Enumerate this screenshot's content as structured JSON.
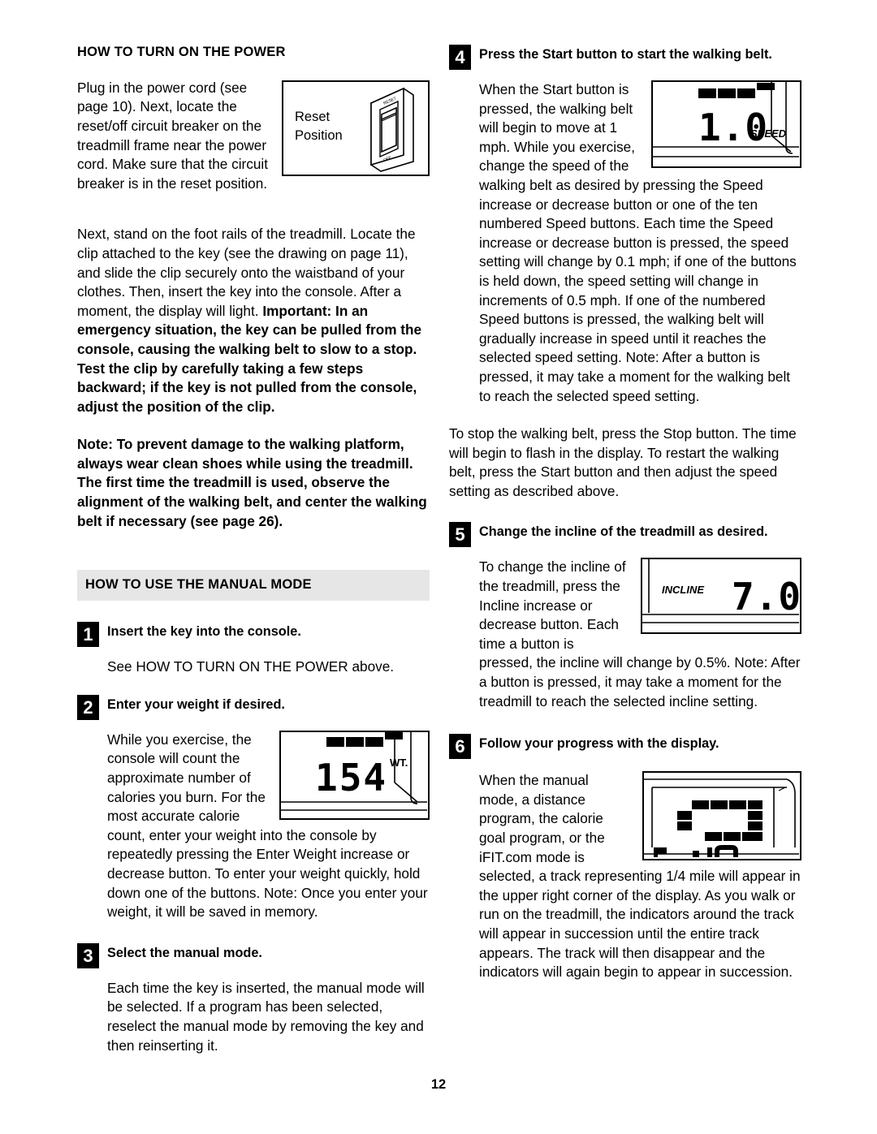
{
  "page": {
    "number": "12"
  },
  "left_column": {
    "section1": {
      "title": "HOW TO TURN ON THE POWER",
      "paragraph1": "Plug in the power cord (see page 10). Next, locate the reset/off circuit breaker on the treadmill frame near the power cord. Make sure that the circuit breaker is in the  reset  position.",
      "figure": {
        "name": "circuit-breaker-switch",
        "label_line1": "Reset",
        "label_line2": "Position",
        "switch_top_label": "RESET",
        "switch_bottom_label": "OFF"
      },
      "paragraph2_normal": "Next, stand on the foot rails of the treadmill. Locate the clip attached to the key (see the drawing on page 11), and slide the clip securely onto the waistband of your clothes. Then, insert the key into the console. After a moment, the display will light. ",
      "paragraph2_bold": "Important: In an emergency situation, the key can be pulled from the console, causing the walking belt to slow to a stop. Test the clip by carefully taking a few steps backward; if the key is not pulled from the console, adjust the position of the clip.",
      "paragraph3_bold": "Note: To prevent damage to the walking platform, always wear clean shoes while using the treadmill. The first time the treadmill is used, observe the alignment of the walking belt, and center the walking belt if necessary (see page 26)."
    },
    "section2": {
      "title": "HOW TO USE THE MANUAL MODE",
      "steps": [
        {
          "number": "1",
          "title": "Insert the key into the console.",
          "body": "See HOW TO TURN ON THE POWER above."
        },
        {
          "number": "2",
          "title": "Enter your weight if desired.",
          "body_wrap": "While you exercise, the console will count the approximate number of calories you burn. For the most accurate calorie count, enter your weight into the console by repeatedly pressing the Enter Weight increase or decrease button. To enter your weight quickly, hold down one of the buttons. Note: Once you enter your weight, it will be saved in memory.",
          "figure": {
            "name": "weight-display",
            "value": "154",
            "unit": "WT.",
            "indicator_segments": 3
          }
        },
        {
          "number": "3",
          "title": "Select the manual mode.",
          "body": "Each time the key is inserted, the manual mode will be selected. If a program has been selected, reselect the manual mode by removing the key and then reinserting it."
        }
      ]
    }
  },
  "right_column": {
    "steps": [
      {
        "number": "4",
        "title": "Press the Start button to start the walking belt.",
        "body_wrap": "When the Start button is pressed, the walking belt will begin to move at 1 mph. While you exercise, change the speed of the walking belt as desired by pressing the Speed increase or decrease button or one of the ten numbered Speed buttons. Each time the Speed increase or decrease button is pressed, the speed setting will change by 0.1 mph; if one of the buttons is held down, the speed setting will change in increments of 0.5 mph. If one of the numbered Speed buttons is pressed, the walking belt will gradually increase in speed until it reaches the selected speed setting. Note: After a button is pressed, it may take a moment for the walking belt to reach the selected speed setting.",
        "body2": "To stop the walking belt, press the Stop button. The time will begin to flash in the display. To restart the walking belt, press the Start button and then adjust the speed setting as described above.",
        "figure": {
          "name": "speed-display",
          "value": "1.0",
          "unit": "SPEED",
          "indicator_segments": 3
        }
      },
      {
        "number": "5",
        "title": "Change the incline of the treadmill as desired.",
        "body_wrap": "To change the incline of the treadmill, press the Incline increase or decrease button. Each time a button is pressed, the incline will change by 0.5%. Note: After a button is pressed, it may take a moment for the treadmill to reach the selected incline setting.",
        "figure": {
          "name": "incline-display",
          "label": "INCLINE",
          "value": "7.0"
        }
      },
      {
        "number": "6",
        "title": "Follow your progress with the display.",
        "body_wrap": "When the manual mode, a distance program, the calorie goal program, or the iFIT.com mode is selected, a track representing 1/4 mile will appear in the upper right corner of the display. As you walk or run on the treadmill, the indicators around the track will appear in succession until the entire track appears. The track will then disappear and the indicators will again begin to appear in succession.",
        "figure": {
          "name": "track-display",
          "description": "oval track made of rectangular indicator segments"
        }
      }
    ]
  },
  "colors": {
    "band_background": "#e6e6e6",
    "ink": "#000000",
    "paper": "#ffffff"
  }
}
